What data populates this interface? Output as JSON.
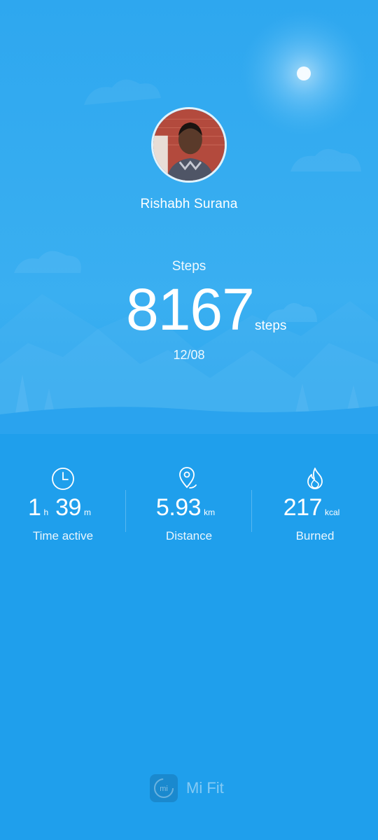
{
  "profile": {
    "name": "Rishabh Surana"
  },
  "steps": {
    "caption": "Steps",
    "value": "8167",
    "unit": "steps",
    "date": "12/08"
  },
  "stats": [
    {
      "icon": "clock-icon",
      "value_parts": [
        {
          "text": "1",
          "size": "big"
        },
        {
          "text": "h",
          "size": "small"
        },
        {
          "text": "39",
          "size": "big"
        },
        {
          "text": "m",
          "size": "small"
        }
      ],
      "label": "Time active"
    },
    {
      "icon": "location-pin-icon",
      "value_parts": [
        {
          "text": "5.93",
          "size": "big"
        },
        {
          "text": "km",
          "size": "small"
        }
      ],
      "label": "Distance"
    },
    {
      "icon": "flame-icon",
      "value_parts": [
        {
          "text": "217",
          "size": "big"
        },
        {
          "text": "kcal",
          "size": "small"
        }
      ],
      "label": "Burned"
    }
  ],
  "brand": {
    "logo_text": "mi",
    "name": "Mi Fit"
  },
  "colors": {
    "background": "#1f9fec",
    "sky": "#35acf0",
    "text": "#ffffff"
  }
}
